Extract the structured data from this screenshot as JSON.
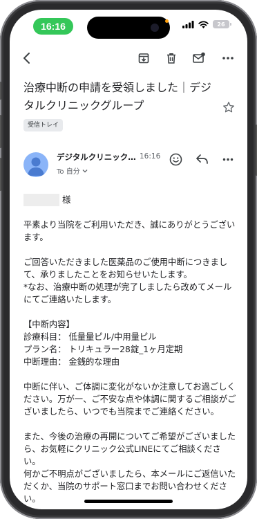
{
  "status_bar": {
    "time": "16:16",
    "battery": "26",
    "accent_color": "#34c759"
  },
  "toolbar": {
    "icons": [
      "back-arrow-icon",
      "archive-icon",
      "trash-icon",
      "mark-unread-icon",
      "more-icon"
    ]
  },
  "email": {
    "subject": "治療中断の申請を受領しました｜デジタルクリニックグループ",
    "label": "受信トレイ",
    "sender": "デジタルクリニック…",
    "time": "16:16",
    "recipient": "To 自分",
    "salutation": "様",
    "body": "平素より当院をご利用いただき、誠にありがとうございます。\n\nご回答いただきました医薬品のご使用中断につきまして、承りましたことをお知らせいたします。\n*なお、治療中断の処理が完了しましたら改めてメールにてご連絡いたします。\n\n【中断内容】\n診療科目： 低量量ピル/中用量ピル\nプラン名： トリキュラー28錠_1ヶ月定期\n中断理由： 金銭的な理由\n\n中断に伴い、ご体調に変化がないか注意してお過ごしください。万が一、ご不安な点や体調に関するご相談がございましたら、いつでも当院までご連絡ください。\n\nまた、今後の治療の再開についてご希望がございましたら、お気軽にクリニック公式LINEにてご相談ください。\n何かご不明点がございましたら、本メールにご返信いただくか、当院のサポート窓口までお問い合わせください。"
  }
}
